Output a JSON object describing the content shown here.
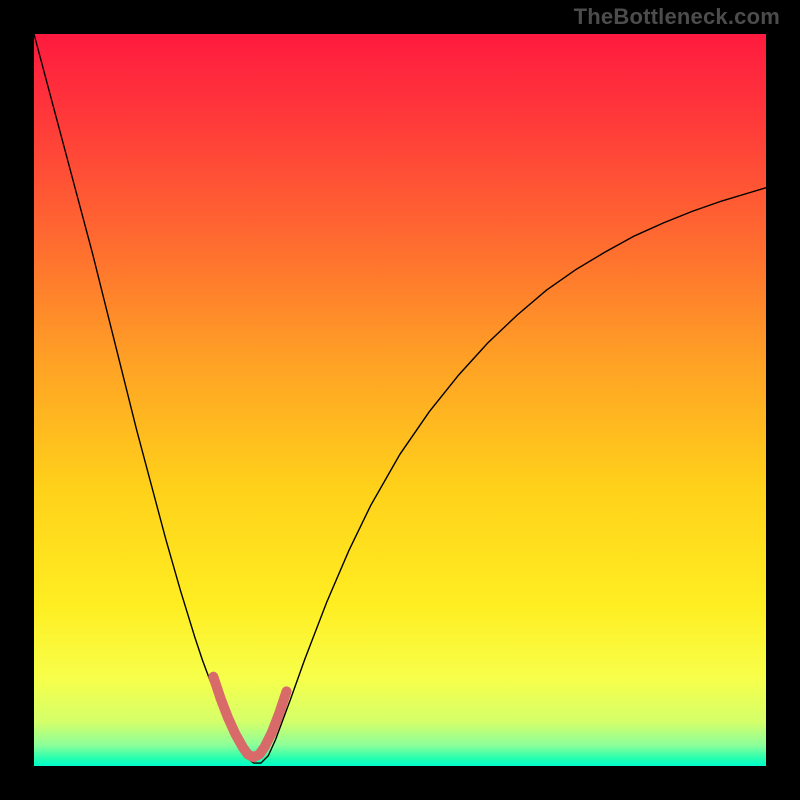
{
  "watermark": "TheBottleneck.com",
  "chart_data": {
    "type": "line",
    "title": "",
    "xlabel": "",
    "ylabel": "",
    "xlim": [
      0,
      100
    ],
    "ylim": [
      0,
      100
    ],
    "grid": false,
    "legend": false,
    "background_gradient": {
      "stops": [
        {
          "offset": 0.0,
          "color": "#ff1a3f"
        },
        {
          "offset": 0.12,
          "color": "#ff3a3a"
        },
        {
          "offset": 0.28,
          "color": "#ff6a30"
        },
        {
          "offset": 0.45,
          "color": "#ffa225"
        },
        {
          "offset": 0.62,
          "color": "#ffd11a"
        },
        {
          "offset": 0.78,
          "color": "#ffee22"
        },
        {
          "offset": 0.88,
          "color": "#f7ff4a"
        },
        {
          "offset": 0.94,
          "color": "#d4ff6a"
        },
        {
          "offset": 0.972,
          "color": "#8aff9a"
        },
        {
          "offset": 0.99,
          "color": "#22ffb0"
        },
        {
          "offset": 1.0,
          "color": "#00ffcc"
        }
      ]
    },
    "series": [
      {
        "name": "primary-curve",
        "color": "#000000",
        "width": 1.4,
        "x": [
          0.0,
          2.0,
          4.0,
          6.0,
          8.0,
          10.0,
          12.0,
          14.0,
          16.0,
          18.0,
          20.0,
          22.0,
          23.0,
          24.0,
          25.0,
          26.0,
          27.0,
          28.0,
          29.0,
          30.0,
          31.0,
          32.0,
          33.0,
          35.0,
          37.0,
          40.0,
          43.0,
          46.0,
          50.0,
          54.0,
          58.0,
          62.0,
          66.0,
          70.0,
          74.0,
          78.0,
          82.0,
          86.0,
          90.0,
          94.0,
          98.0,
          100.0
        ],
        "y": [
          100.0,
          92.5,
          85.0,
          77.5,
          70.0,
          62.0,
          54.0,
          46.0,
          38.5,
          31.0,
          24.0,
          17.5,
          14.5,
          11.8,
          9.4,
          7.0,
          4.6,
          2.6,
          1.2,
          0.4,
          0.4,
          1.4,
          3.6,
          9.0,
          14.6,
          22.4,
          29.4,
          35.6,
          42.6,
          48.4,
          53.4,
          57.8,
          61.6,
          65.0,
          67.8,
          70.2,
          72.4,
          74.2,
          75.8,
          77.2,
          78.4,
          79.0
        ]
      },
      {
        "name": "minimum-highlight",
        "color": "#d86a6a",
        "width": 10,
        "linecap": "round",
        "x": [
          24.5,
          25.5,
          26.5,
          27.5,
          28.5,
          29.2,
          30.0,
          30.8,
          31.5,
          32.5,
          33.5,
          34.5
        ],
        "y": [
          12.2,
          9.2,
          6.6,
          4.4,
          2.6,
          1.6,
          1.2,
          1.6,
          2.6,
          4.6,
          7.2,
          10.2
        ]
      }
    ]
  }
}
